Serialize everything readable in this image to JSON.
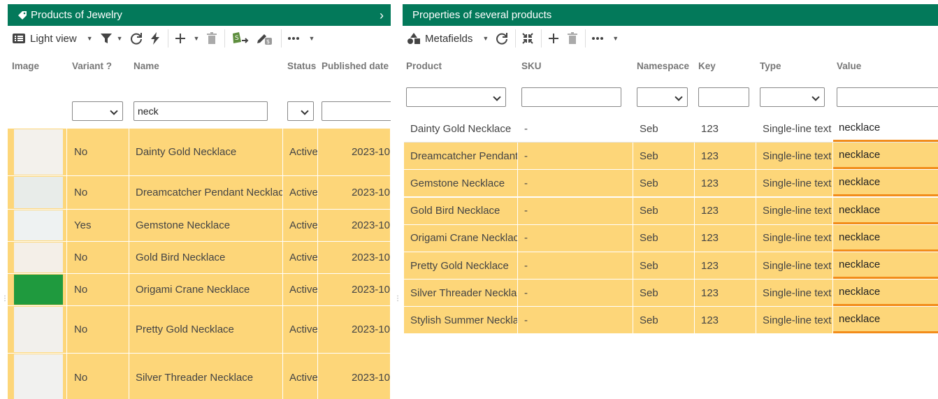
{
  "left": {
    "title": "Products of Jewelry",
    "toolbar": {
      "view_label": "Light view"
    },
    "columns": [
      "Image",
      "Variant ?",
      "Name",
      "Status",
      "Published date"
    ],
    "filters": {
      "name_value": "neck"
    },
    "rows": [
      {
        "variant": "No",
        "name": "Dainty Gold Necklace",
        "status": "Active",
        "date": "2023-10",
        "thumb": "#f3f1ec"
      },
      {
        "variant": "No",
        "name": "Dreamcatcher Pendant Necklace",
        "status": "Active",
        "date": "2023-10",
        "thumb": "#e8ece9"
      },
      {
        "variant": "Yes",
        "name": "Gemstone Necklace",
        "status": "Active",
        "date": "2023-10",
        "thumb": "#eef2f2"
      },
      {
        "variant": "No",
        "name": "Gold Bird Necklace",
        "status": "Active",
        "date": "2023-10",
        "thumb": "#f4efe8"
      },
      {
        "variant": "No",
        "name": "Origami Crane Necklace",
        "status": "Active",
        "date": "2023-10",
        "thumb": "#1f9a3e"
      },
      {
        "variant": "No",
        "name": "Pretty Gold Necklace",
        "status": "Active",
        "date": "2023-10",
        "thumb": "#f2f0ec"
      },
      {
        "variant": "No",
        "name": "Silver Threader Necklace",
        "status": "Active",
        "date": "2023-10",
        "thumb": "#f1f1ef"
      }
    ]
  },
  "right": {
    "title": "Properties of several products",
    "toolbar": {
      "view_label": "Metafields"
    },
    "columns": [
      "Product",
      "SKU",
      "Namespace",
      "Key",
      "Type",
      "Value"
    ],
    "rows": [
      {
        "product": "Dainty Gold Necklace",
        "sku": "-",
        "namespace": "Seb",
        "key": "123",
        "type": "Single-line text",
        "value": "necklace"
      },
      {
        "product": "Dreamcatcher Pendant Necklace",
        "sku": "-",
        "namespace": "Seb",
        "key": "123",
        "type": "Single-line text",
        "value": "necklace"
      },
      {
        "product": "Gemstone Necklace",
        "sku": "-",
        "namespace": "Seb",
        "key": "123",
        "type": "Single-line text",
        "value": "necklace"
      },
      {
        "product": "Gold Bird Necklace",
        "sku": "-",
        "namespace": "Seb",
        "key": "123",
        "type": "Single-line text",
        "value": "necklace"
      },
      {
        "product": "Origami Crane Necklace",
        "sku": "-",
        "namespace": "Seb",
        "key": "123",
        "type": "Single-line text",
        "value": "necklace"
      },
      {
        "product": "Pretty Gold Necklace",
        "sku": "-",
        "namespace": "Seb",
        "key": "123",
        "type": "Single-line text",
        "value": "necklace"
      },
      {
        "product": "Silver Threader Necklace",
        "sku": "-",
        "namespace": "Seb",
        "key": "123",
        "type": "Single-line text",
        "value": "necklace"
      },
      {
        "product": "Stylish Summer Necklace",
        "sku": "-",
        "namespace": "Seb",
        "key": "123",
        "type": "Single-line text",
        "value": "necklace"
      }
    ]
  },
  "colors": {
    "header_green": "#03795a",
    "row_highlight": "#fdd679",
    "value_underline": "#f28c1a"
  }
}
